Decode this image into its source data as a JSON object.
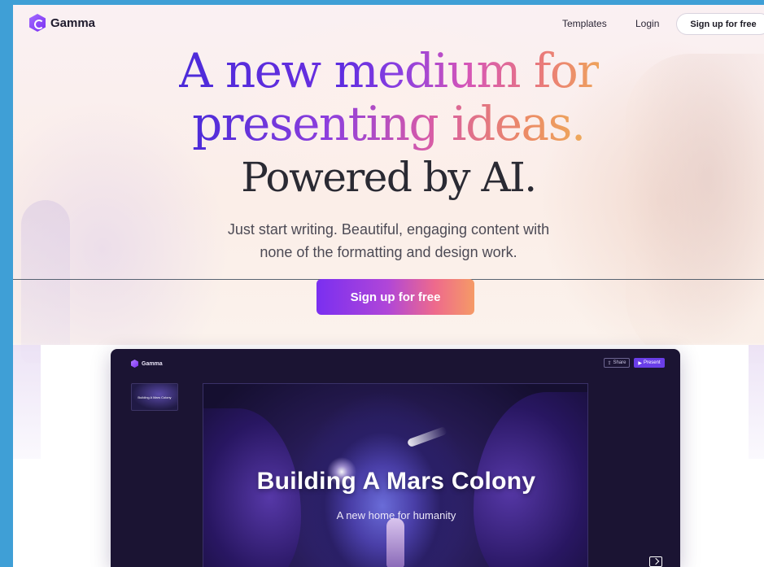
{
  "nav": {
    "logo_text": "Gamma",
    "templates_label": "Templates",
    "login_label": "Login",
    "signup_label": "Sign up for free"
  },
  "hero": {
    "line1_dark": "A new ",
    "line1_grad": "medium for",
    "line2": "presenting ideas.",
    "line3": "Powered by AI.",
    "subtext_line1": "Just start writing. Beautiful, engaging content with",
    "subtext_line2": "none of the formatting and design work.",
    "cta_label": "Sign up for free"
  },
  "preview": {
    "logo_text": "Gamma",
    "share_label": "Share",
    "present_label": "Present",
    "thumbnail_text": "Building A Mars Colony",
    "slide_title": "Building A Mars Colony",
    "slide_subtitle": "A new home for humanity"
  },
  "colors": {
    "accent_purple": "#7a2ff0",
    "accent_orange": "#f59a66",
    "text_dark": "#2a2a33",
    "outer_background": "#3f9fd6"
  }
}
